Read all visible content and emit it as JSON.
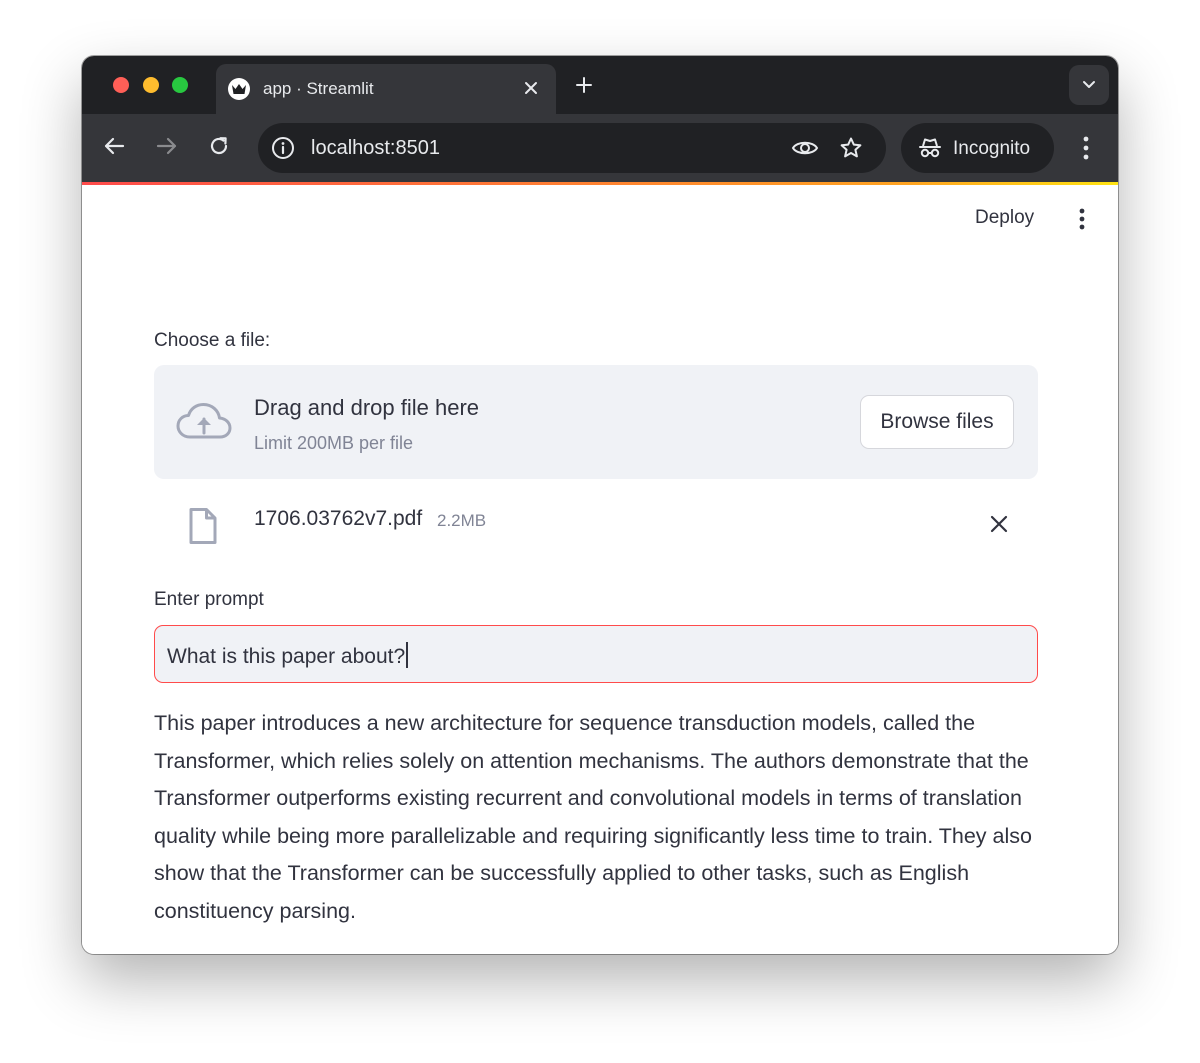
{
  "browser": {
    "tab": {
      "title": "app · Streamlit"
    },
    "address_bar": {
      "url": "localhost:8501"
    },
    "profile": {
      "label": "Incognito"
    }
  },
  "app": {
    "header": {
      "deploy_label": "Deploy"
    },
    "file_uploader": {
      "label": "Choose a file:",
      "dropzone_title": "Drag and drop file here",
      "dropzone_limit": "Limit 200MB per file",
      "browse_label": "Browse files",
      "uploaded_file": {
        "name": "1706.03762v7.pdf",
        "size": "2.2MB"
      }
    },
    "prompt": {
      "label": "Enter prompt",
      "value": "What is this paper about?"
    },
    "response": "This paper introduces a new architecture for sequence transduction models, called the Transformer, which relies solely on attention mechanisms. The authors demonstrate that the Transformer outperforms existing recurrent and convolutional models in terms of translation quality while being more parallelizable and requiring significantly less time to train. They also show that the Transformer can be successfully applied to other tasks, such as English constituency parsing."
  },
  "colors": {
    "accent": "#ff4b4b",
    "text": "#31333f",
    "muted": "#808495",
    "dropzone_bg": "#f0f2f6",
    "chrome_dark": "#202124",
    "chrome_toolbar": "#35363a"
  }
}
